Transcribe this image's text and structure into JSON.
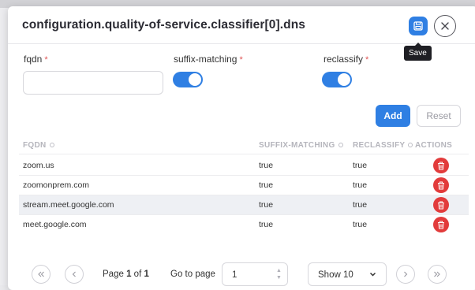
{
  "modal": {
    "title": "configuration.quality-of-service.classifier[0].dns",
    "save_tooltip": "Save"
  },
  "form": {
    "fqdn_label": "fqdn",
    "fqdn_value": "",
    "suffix_matching_label": "suffix-matching",
    "suffix_matching_on": true,
    "reclassify_label": "reclassify",
    "reclassify_on": true,
    "required_mark": "*",
    "add_label": "Add",
    "reset_label": "Reset"
  },
  "table": {
    "columns": [
      "FQDN",
      "SUFFIX-MATCHING",
      "RECLASSIFY",
      "ACTIONS"
    ],
    "rows": [
      {
        "fqdn": "zoom.us",
        "suffix_matching": "true",
        "reclassify": "true"
      },
      {
        "fqdn": "zoomonprem.com",
        "suffix_matching": "true",
        "reclassify": "true"
      },
      {
        "fqdn": "stream.meet.google.com",
        "suffix_matching": "true",
        "reclassify": "true"
      },
      {
        "fqdn": "meet.google.com",
        "suffix_matching": "true",
        "reclassify": "true"
      }
    ]
  },
  "pagination": {
    "page_prefix": "Page",
    "current_page": "1",
    "of_label": "of",
    "total_pages": "1",
    "go_to_label": "Go to page",
    "go_to_value": "1",
    "show_value": "Show 10"
  },
  "colors": {
    "accent": "#2f7fe3",
    "danger": "#e23b3b"
  },
  "icons": [
    "save-icon",
    "close-icon",
    "sort-icon",
    "trash-icon",
    "first-page-icon",
    "prev-page-icon",
    "next-page-icon",
    "last-page-icon",
    "chevron-down-icon"
  ]
}
